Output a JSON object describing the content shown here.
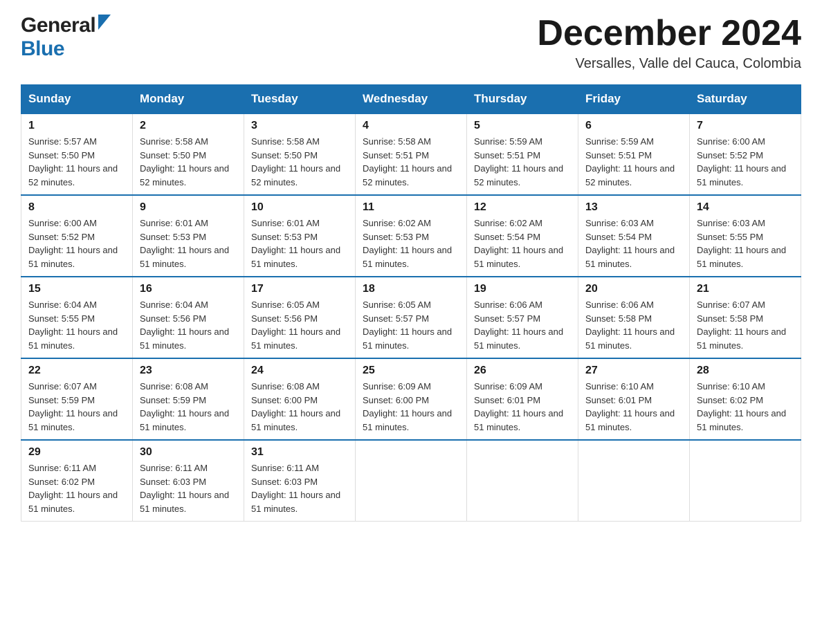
{
  "header": {
    "logo_general": "General",
    "logo_blue": "Blue",
    "month_title": "December 2024",
    "location": "Versalles, Valle del Cauca, Colombia"
  },
  "days_of_week": [
    "Sunday",
    "Monday",
    "Tuesday",
    "Wednesday",
    "Thursday",
    "Friday",
    "Saturday"
  ],
  "weeks": [
    [
      {
        "day": "1",
        "sunrise": "Sunrise: 5:57 AM",
        "sunset": "Sunset: 5:50 PM",
        "daylight": "Daylight: 11 hours and 52 minutes."
      },
      {
        "day": "2",
        "sunrise": "Sunrise: 5:58 AM",
        "sunset": "Sunset: 5:50 PM",
        "daylight": "Daylight: 11 hours and 52 minutes."
      },
      {
        "day": "3",
        "sunrise": "Sunrise: 5:58 AM",
        "sunset": "Sunset: 5:50 PM",
        "daylight": "Daylight: 11 hours and 52 minutes."
      },
      {
        "day": "4",
        "sunrise": "Sunrise: 5:58 AM",
        "sunset": "Sunset: 5:51 PM",
        "daylight": "Daylight: 11 hours and 52 minutes."
      },
      {
        "day": "5",
        "sunrise": "Sunrise: 5:59 AM",
        "sunset": "Sunset: 5:51 PM",
        "daylight": "Daylight: 11 hours and 52 minutes."
      },
      {
        "day": "6",
        "sunrise": "Sunrise: 5:59 AM",
        "sunset": "Sunset: 5:51 PM",
        "daylight": "Daylight: 11 hours and 52 minutes."
      },
      {
        "day": "7",
        "sunrise": "Sunrise: 6:00 AM",
        "sunset": "Sunset: 5:52 PM",
        "daylight": "Daylight: 11 hours and 51 minutes."
      }
    ],
    [
      {
        "day": "8",
        "sunrise": "Sunrise: 6:00 AM",
        "sunset": "Sunset: 5:52 PM",
        "daylight": "Daylight: 11 hours and 51 minutes."
      },
      {
        "day": "9",
        "sunrise": "Sunrise: 6:01 AM",
        "sunset": "Sunset: 5:53 PM",
        "daylight": "Daylight: 11 hours and 51 minutes."
      },
      {
        "day": "10",
        "sunrise": "Sunrise: 6:01 AM",
        "sunset": "Sunset: 5:53 PM",
        "daylight": "Daylight: 11 hours and 51 minutes."
      },
      {
        "day": "11",
        "sunrise": "Sunrise: 6:02 AM",
        "sunset": "Sunset: 5:53 PM",
        "daylight": "Daylight: 11 hours and 51 minutes."
      },
      {
        "day": "12",
        "sunrise": "Sunrise: 6:02 AM",
        "sunset": "Sunset: 5:54 PM",
        "daylight": "Daylight: 11 hours and 51 minutes."
      },
      {
        "day": "13",
        "sunrise": "Sunrise: 6:03 AM",
        "sunset": "Sunset: 5:54 PM",
        "daylight": "Daylight: 11 hours and 51 minutes."
      },
      {
        "day": "14",
        "sunrise": "Sunrise: 6:03 AM",
        "sunset": "Sunset: 5:55 PM",
        "daylight": "Daylight: 11 hours and 51 minutes."
      }
    ],
    [
      {
        "day": "15",
        "sunrise": "Sunrise: 6:04 AM",
        "sunset": "Sunset: 5:55 PM",
        "daylight": "Daylight: 11 hours and 51 minutes."
      },
      {
        "day": "16",
        "sunrise": "Sunrise: 6:04 AM",
        "sunset": "Sunset: 5:56 PM",
        "daylight": "Daylight: 11 hours and 51 minutes."
      },
      {
        "day": "17",
        "sunrise": "Sunrise: 6:05 AM",
        "sunset": "Sunset: 5:56 PM",
        "daylight": "Daylight: 11 hours and 51 minutes."
      },
      {
        "day": "18",
        "sunrise": "Sunrise: 6:05 AM",
        "sunset": "Sunset: 5:57 PM",
        "daylight": "Daylight: 11 hours and 51 minutes."
      },
      {
        "day": "19",
        "sunrise": "Sunrise: 6:06 AM",
        "sunset": "Sunset: 5:57 PM",
        "daylight": "Daylight: 11 hours and 51 minutes."
      },
      {
        "day": "20",
        "sunrise": "Sunrise: 6:06 AM",
        "sunset": "Sunset: 5:58 PM",
        "daylight": "Daylight: 11 hours and 51 minutes."
      },
      {
        "day": "21",
        "sunrise": "Sunrise: 6:07 AM",
        "sunset": "Sunset: 5:58 PM",
        "daylight": "Daylight: 11 hours and 51 minutes."
      }
    ],
    [
      {
        "day": "22",
        "sunrise": "Sunrise: 6:07 AM",
        "sunset": "Sunset: 5:59 PM",
        "daylight": "Daylight: 11 hours and 51 minutes."
      },
      {
        "day": "23",
        "sunrise": "Sunrise: 6:08 AM",
        "sunset": "Sunset: 5:59 PM",
        "daylight": "Daylight: 11 hours and 51 minutes."
      },
      {
        "day": "24",
        "sunrise": "Sunrise: 6:08 AM",
        "sunset": "Sunset: 6:00 PM",
        "daylight": "Daylight: 11 hours and 51 minutes."
      },
      {
        "day": "25",
        "sunrise": "Sunrise: 6:09 AM",
        "sunset": "Sunset: 6:00 PM",
        "daylight": "Daylight: 11 hours and 51 minutes."
      },
      {
        "day": "26",
        "sunrise": "Sunrise: 6:09 AM",
        "sunset": "Sunset: 6:01 PM",
        "daylight": "Daylight: 11 hours and 51 minutes."
      },
      {
        "day": "27",
        "sunrise": "Sunrise: 6:10 AM",
        "sunset": "Sunset: 6:01 PM",
        "daylight": "Daylight: 11 hours and 51 minutes."
      },
      {
        "day": "28",
        "sunrise": "Sunrise: 6:10 AM",
        "sunset": "Sunset: 6:02 PM",
        "daylight": "Daylight: 11 hours and 51 minutes."
      }
    ],
    [
      {
        "day": "29",
        "sunrise": "Sunrise: 6:11 AM",
        "sunset": "Sunset: 6:02 PM",
        "daylight": "Daylight: 11 hours and 51 minutes."
      },
      {
        "day": "30",
        "sunrise": "Sunrise: 6:11 AM",
        "sunset": "Sunset: 6:03 PM",
        "daylight": "Daylight: 11 hours and 51 minutes."
      },
      {
        "day": "31",
        "sunrise": "Sunrise: 6:11 AM",
        "sunset": "Sunset: 6:03 PM",
        "daylight": "Daylight: 11 hours and 51 minutes."
      },
      null,
      null,
      null,
      null
    ]
  ]
}
